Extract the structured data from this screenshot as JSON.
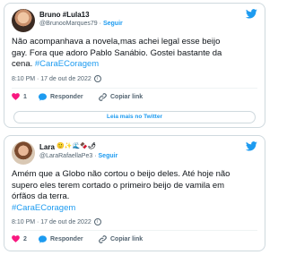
{
  "tweets": [
    {
      "display_name": "Bruno #Lula13",
      "handle": "@BrunooMarques79",
      "separator": "·",
      "follow_label": "Seguir",
      "text_lines": [
        "Não acompanhava a novela,mas achei legal esse beijo",
        "gay. Fora que adoro Pablo Sanábio. Gostei bastante da",
        "cena."
      ],
      "hashtag": "#CaraECoragem",
      "timestamp": "8:10 PM · 17 de out de 2022",
      "info_icon": "i",
      "likes": "1",
      "reply_label": "Responder",
      "copy_label": "Copiar link",
      "read_more_label": "Leia mais no Twitter"
    },
    {
      "display_name": "Lara",
      "name_emojis": "🙂✨🌊🍫🌶",
      "handle": "@LaraRafaellaPe3",
      "separator": "·",
      "follow_label": "Seguir",
      "text_lines": [
        "Amém que a Globo não cortou o beijo deles. Até hoje não",
        "supero eles terem cortado o primeiro beijo de vamila em",
        "órfãos da terra."
      ],
      "hashtag": "#CaraECoragem",
      "timestamp": "8:10 PM · 17 de out de 2022",
      "info_icon": "i",
      "likes": "2",
      "reply_label": "Responder",
      "copy_label": "Copiar link"
    }
  ],
  "colors": {
    "accent": "#1d9bf0",
    "like": "#f91880",
    "text": "#0f1419",
    "muted": "#536471",
    "border": "#cfd9de"
  },
  "icons": {
    "platform": "twitter-bird-icon",
    "like": "heart-icon",
    "reply": "speech-bubble-icon",
    "copy": "link-icon"
  }
}
